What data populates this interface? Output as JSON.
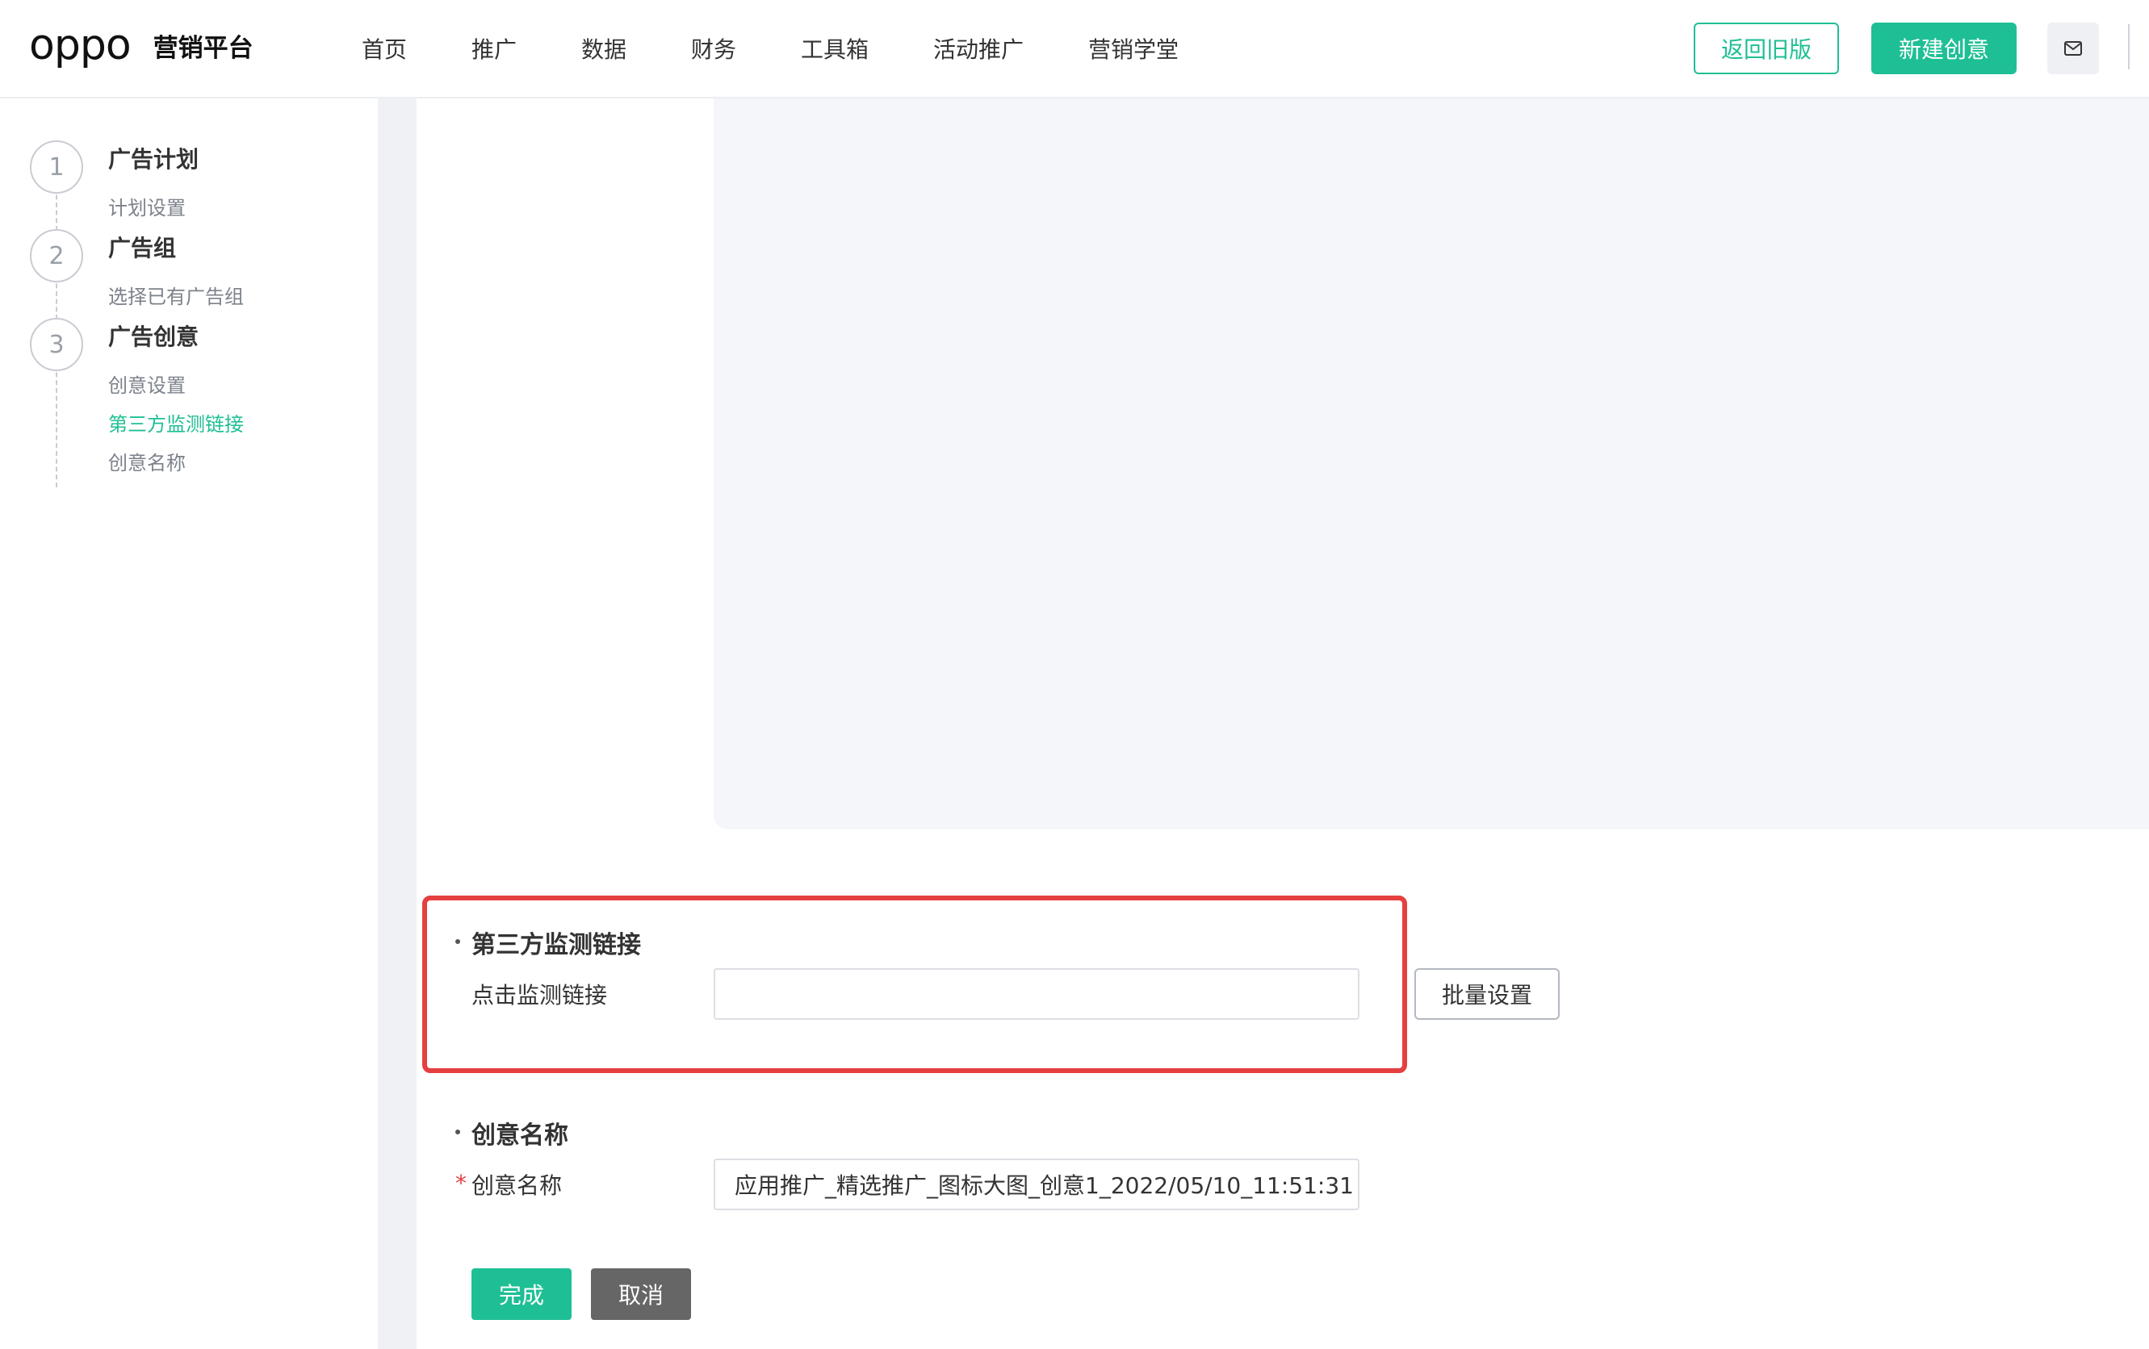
{
  "header": {
    "logo_mark": "oppo",
    "platform_name": "营销平台",
    "nav": [
      "首页",
      "推广",
      "数据",
      "财务",
      "工具箱",
      "活动推广",
      "营销学堂"
    ],
    "return_old_label": "返回旧版",
    "new_creative_label": "新建创意",
    "mail_icon": "mail-icon"
  },
  "sidebar": {
    "steps": [
      {
        "number": "1",
        "title": "广告计划",
        "subs": [
          "计划设置"
        ]
      },
      {
        "number": "2",
        "title": "广告组",
        "subs": [
          "选择已有广告组"
        ]
      },
      {
        "number": "3",
        "title": "广告创意",
        "subs": [
          "创意设置",
          "第三方监测链接",
          "创意名称"
        ]
      }
    ],
    "active_sub": "第三方监测链接"
  },
  "form": {
    "tracking_section_title": "第三方监测链接",
    "click_tracking_label": "点击监测链接",
    "click_tracking_value": "",
    "batch_setting_label": "批量设置",
    "name_section_title": "创意名称",
    "name_label": "创意名称",
    "required_mark": "*",
    "name_value": "应用推广_精选推广_图标大图_创意1_2022/05/10_11:51:31",
    "done_label": "完成",
    "cancel_label": "取消"
  },
  "colors": {
    "accent": "#1fbf95",
    "highlight_border": "#e5403f",
    "cancel_bg": "#666666"
  }
}
